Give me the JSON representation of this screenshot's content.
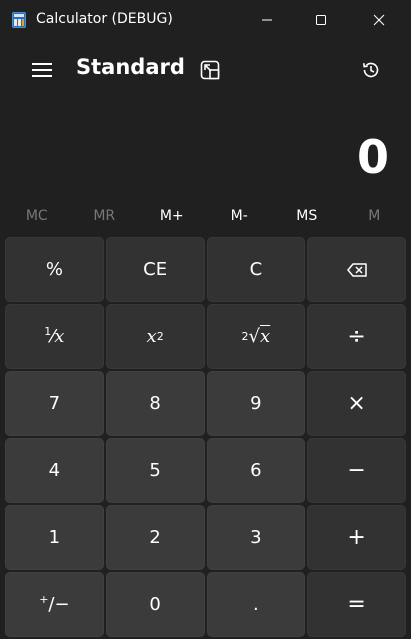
{
  "window": {
    "title": "Calculator (DEBUG)",
    "controls": [
      "minimize",
      "maximize",
      "close"
    ]
  },
  "header": {
    "mode": "Standard",
    "icons": [
      "hamburger-menu-icon",
      "keep-on-top-icon",
      "history-icon"
    ]
  },
  "display": {
    "value": "0"
  },
  "memory": [
    {
      "label": "MC",
      "enabled": false
    },
    {
      "label": "MR",
      "enabled": false
    },
    {
      "label": "M+",
      "enabled": true
    },
    {
      "label": "M-",
      "enabled": true
    },
    {
      "label": "MS",
      "enabled": true
    },
    {
      "label": "M",
      "enabled": false
    }
  ],
  "keys": {
    "percent": "%",
    "clear_entry": "CE",
    "clear": "C",
    "reciprocal_num": "1",
    "reciprocal_den": "x",
    "square_base": "x",
    "square_exp": "2",
    "sqrt_index": "2",
    "sqrt_radicand": "x",
    "divide": "÷",
    "seven": "7",
    "eight": "8",
    "nine": "9",
    "multiply": "×",
    "four": "4",
    "five": "5",
    "six": "6",
    "minus": "−",
    "one": "1",
    "two": "2",
    "three": "3",
    "plus": "+",
    "negate_plus": "+",
    "negate_minus": "/−",
    "zero": "0",
    "decimal": ".",
    "equals": "="
  },
  "colors": {
    "background": "#202020",
    "operator_key": "#323232",
    "number_key": "#3b3b3b",
    "disabled_text": "#777777"
  }
}
